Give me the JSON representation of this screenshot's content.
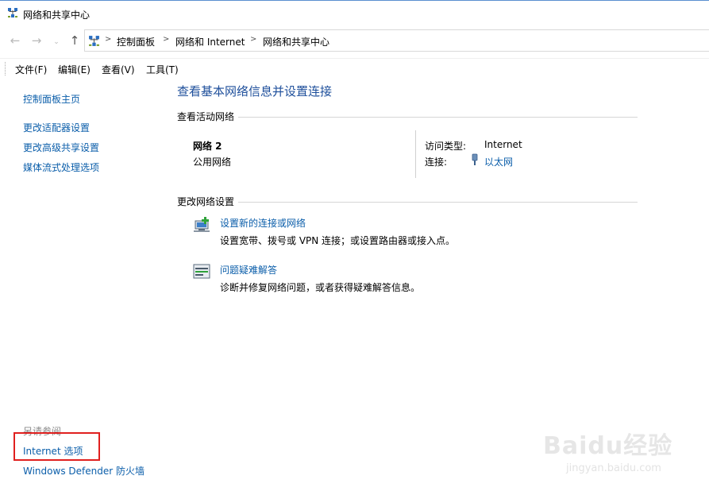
{
  "window": {
    "title": "网络和共享中心"
  },
  "address": {
    "crumbs": [
      "控制面板",
      "网络和 Internet",
      "网络和共享中心"
    ],
    "separator": ">"
  },
  "menu": {
    "items": [
      "文件(F)",
      "编辑(E)",
      "查看(V)",
      "工具(T)"
    ]
  },
  "sidebar": {
    "home": "控制面板主页",
    "links": [
      "更改适配器设置",
      "更改高级共享设置",
      "媒体流式处理选项"
    ],
    "see_also_label": "另请参阅",
    "see_also": [
      "Internet 选项",
      "Windows Defender 防火墙"
    ]
  },
  "main": {
    "title": "查看基本网络信息并设置连接",
    "active_header": "查看活动网络",
    "network": {
      "name": "网络 2",
      "category": "公用网络",
      "access_type_label": "访问类型:",
      "access_type_value": "Internet",
      "connection_label": "连接:",
      "connection_value": "以太网"
    },
    "change_header": "更改网络设置",
    "tasks": [
      {
        "title": "设置新的连接或网络",
        "desc": "设置宽带、拨号或 VPN 连接；或设置路由器或接入点。",
        "icon": "network-setup-icon"
      },
      {
        "title": "问题疑难解答",
        "desc": "诊断并修复网络问题，或者获得疑难解答信息。",
        "icon": "troubleshoot-icon"
      }
    ]
  },
  "watermark": {
    "brand": "Baidu经验",
    "url": "jingyan.baidu.com"
  },
  "colors": {
    "link": "#0b5eaa",
    "title": "#1e4f9b",
    "highlight_box": "#e0201f"
  }
}
